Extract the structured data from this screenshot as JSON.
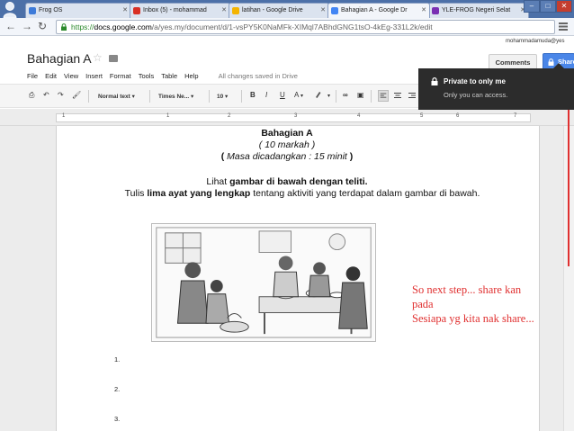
{
  "browser": {
    "tabs": [
      {
        "label": "Frog OS",
        "favicon_color": "#3d7bd9",
        "active": false
      },
      {
        "label": "Inbox (5) - mohammad",
        "favicon_color": "#d93025",
        "active": false
      },
      {
        "label": "latihan - Google Drive",
        "favicon_color": "#f4b400",
        "active": false
      },
      {
        "label": "Bahagian A - Google Dr",
        "favicon_color": "#4285f4",
        "active": true
      },
      {
        "label": "YLE-FROG Negeri Selat",
        "favicon_color": "#7a2fb3",
        "active": false
      }
    ],
    "url_scheme": "https://",
    "url_host": "docs.google.com",
    "url_path": "/a/yes.my/document/d/1-vsPY5K0NaMFk-XIMql7ABhdGNG1tsO-4kEg-331L2k/edit"
  },
  "docs": {
    "user_email": "mohammadamuda@yes",
    "title": "Bahagian A",
    "menu": [
      "File",
      "Edit",
      "View",
      "Insert",
      "Format",
      "Tools",
      "Table",
      "Help"
    ],
    "save_status": "All changes saved in Drive",
    "comments_label": "Comments",
    "share_label": "Share",
    "toolbar": {
      "style": "Normal text",
      "font": "Times Ne...",
      "size": "10",
      "bold": "B",
      "italic": "I",
      "underline": "U",
      "text_color": "A",
      "link": "∞",
      "comment": "▣"
    },
    "share_tip": {
      "title": "Private to only me",
      "subtitle": "Only you can access."
    },
    "ruler_numbers": [
      "1",
      "1",
      "2",
      "3",
      "4",
      "5",
      "6",
      "7"
    ]
  },
  "content": {
    "heading": "Bahagian A",
    "marks": "( 10 markah )",
    "time_prefix": "( ",
    "time_text": "Masa dicadangkan : 15 minit",
    "time_suffix": " )",
    "instr1_pre": "Lihat ",
    "instr1_bold": "gambar di bawah dengan teliti.",
    "instr2_pre": "Tulis ",
    "instr2_bold": "lima ayat yang lengkap",
    "instr2_post": " tentang aktiviti yang terdapat dalam gambar di bawah.",
    "items": [
      "1.",
      "2.",
      "3."
    ]
  },
  "annotation": {
    "line1": "So next step... share kan",
    "line2": "pada",
    "line3": "Sesiapa yg kita nak share...",
    "color": "#e03030"
  }
}
